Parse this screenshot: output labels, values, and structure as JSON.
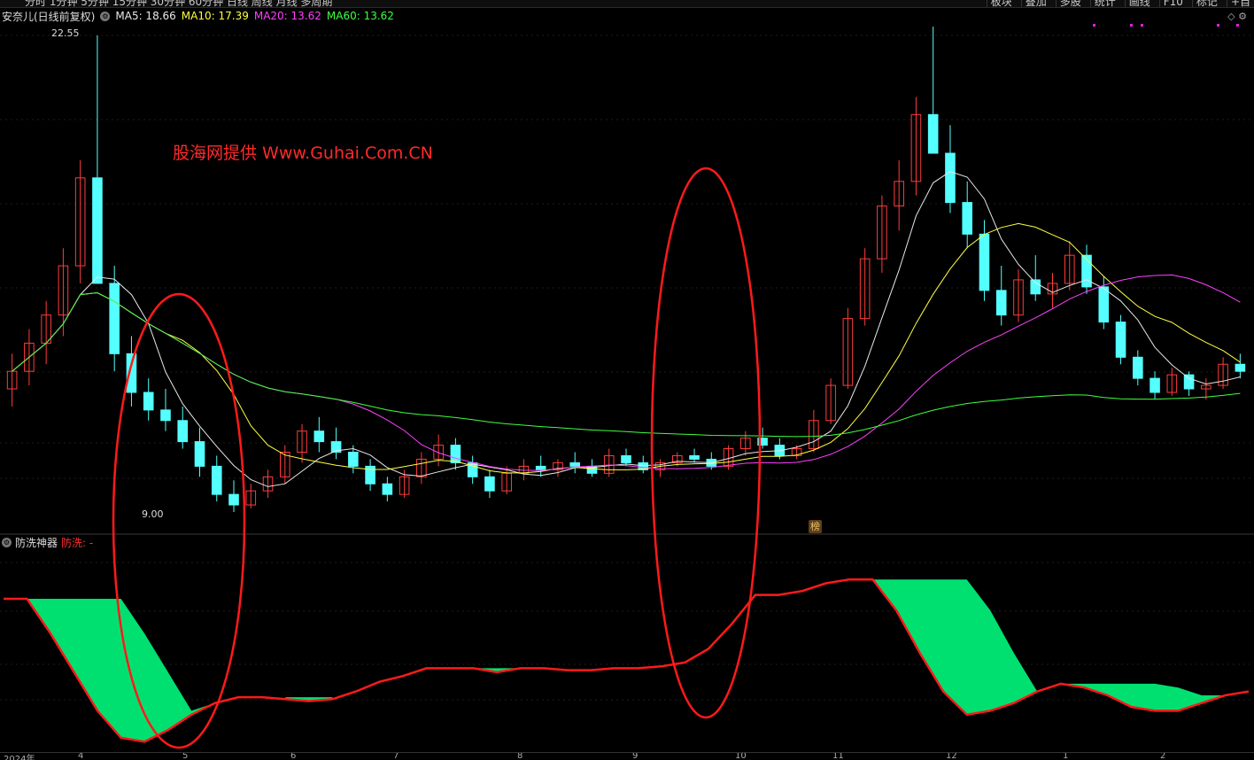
{
  "toolbar": {
    "periods": "分时  1分钟  5分钟  15分钟  30分钟  60分钟  日线  周线  月线  多周期",
    "tools": [
      "板块",
      "叠加",
      "多股",
      "统计",
      "画线",
      "F10",
      "标记",
      "+自"
    ]
  },
  "stock": {
    "name": "安奈儿(日线前复权)",
    "ma5": "MA5: 18.66",
    "ma10": "MA10: 17.39",
    "ma20": "MA20: 13.62",
    "ma60": "MA60: 13.62"
  },
  "annotations": {
    "high": "22.55",
    "low": "9.00",
    "watermark": "股海网提供 Www.Guhai.Com.CN",
    "bang": "榜"
  },
  "indicator": {
    "name": "防洗神器",
    "value": "防洗: -"
  },
  "xaxis": {
    "labels": [
      "2024年",
      "4",
      "5",
      "6",
      "7",
      "8",
      "9",
      "10",
      "11",
      "12",
      "1",
      "2"
    ]
  },
  "colors": {
    "up": "#ff3c3c",
    "down": "#54ffff",
    "ma5": "#e8e8e8",
    "ma10": "#ffff40",
    "ma20": "#ff40ff",
    "ma60": "#40ff40",
    "band": "#00e070",
    "line": "#ff1a1a",
    "ellipse": "#ff1a1a"
  },
  "chart_data": {
    "type": "candlestick",
    "price_range": [
      9.0,
      22.55
    ],
    "candles": [
      {
        "o": 12.5,
        "h": 13.5,
        "l": 12.0,
        "c": 13.0
      },
      {
        "o": 13.0,
        "h": 14.2,
        "l": 12.6,
        "c": 13.8
      },
      {
        "o": 13.8,
        "h": 15.0,
        "l": 13.2,
        "c": 14.6
      },
      {
        "o": 14.6,
        "h": 16.5,
        "l": 14.0,
        "c": 16.0
      },
      {
        "o": 16.0,
        "h": 19.0,
        "l": 15.5,
        "c": 18.5
      },
      {
        "o": 18.5,
        "h": 22.55,
        "l": 17.0,
        "c": 15.5
      },
      {
        "o": 15.5,
        "h": 16.0,
        "l": 13.0,
        "c": 13.5
      },
      {
        "o": 13.5,
        "h": 14.0,
        "l": 12.0,
        "c": 12.4
      },
      {
        "o": 12.4,
        "h": 12.8,
        "l": 11.6,
        "c": 11.9
      },
      {
        "o": 11.9,
        "h": 12.5,
        "l": 11.3,
        "c": 11.6
      },
      {
        "o": 11.6,
        "h": 12.0,
        "l": 10.8,
        "c": 11.0
      },
      {
        "o": 11.0,
        "h": 11.4,
        "l": 10.0,
        "c": 10.3
      },
      {
        "o": 10.3,
        "h": 10.6,
        "l": 9.3,
        "c": 9.5
      },
      {
        "o": 9.5,
        "h": 9.9,
        "l": 9.0,
        "c": 9.2
      },
      {
        "o": 9.2,
        "h": 9.8,
        "l": 9.1,
        "c": 9.6
      },
      {
        "o": 9.6,
        "h": 10.2,
        "l": 9.4,
        "c": 10.0
      },
      {
        "o": 10.0,
        "h": 10.9,
        "l": 9.8,
        "c": 10.7
      },
      {
        "o": 10.7,
        "h": 11.5,
        "l": 10.4,
        "c": 11.3
      },
      {
        "o": 11.3,
        "h": 11.7,
        "l": 10.7,
        "c": 11.0
      },
      {
        "o": 11.0,
        "h": 11.4,
        "l": 10.5,
        "c": 10.7
      },
      {
        "o": 10.7,
        "h": 10.9,
        "l": 10.1,
        "c": 10.3
      },
      {
        "o": 10.3,
        "h": 10.5,
        "l": 9.6,
        "c": 9.8
      },
      {
        "o": 9.8,
        "h": 10.0,
        "l": 9.3,
        "c": 9.5
      },
      {
        "o": 9.5,
        "h": 10.2,
        "l": 9.4,
        "c": 10.0
      },
      {
        "o": 10.0,
        "h": 10.7,
        "l": 9.8,
        "c": 10.5
      },
      {
        "o": 10.5,
        "h": 11.2,
        "l": 10.3,
        "c": 10.9
      },
      {
        "o": 10.9,
        "h": 11.1,
        "l": 10.2,
        "c": 10.4
      },
      {
        "o": 10.4,
        "h": 10.6,
        "l": 9.8,
        "c": 10.0
      },
      {
        "o": 10.0,
        "h": 10.2,
        "l": 9.4,
        "c": 9.6
      },
      {
        "o": 9.6,
        "h": 10.3,
        "l": 9.5,
        "c": 10.1
      },
      {
        "o": 10.1,
        "h": 10.5,
        "l": 9.9,
        "c": 10.3
      },
      {
        "o": 10.3,
        "h": 10.6,
        "l": 10.0,
        "c": 10.2
      },
      {
        "o": 10.2,
        "h": 10.5,
        "l": 10.0,
        "c": 10.4
      },
      {
        "o": 10.4,
        "h": 10.7,
        "l": 10.1,
        "c": 10.3
      },
      {
        "o": 10.3,
        "h": 10.5,
        "l": 10.0,
        "c": 10.1
      },
      {
        "o": 10.1,
        "h": 10.8,
        "l": 10.0,
        "c": 10.6
      },
      {
        "o": 10.6,
        "h": 10.8,
        "l": 10.3,
        "c": 10.4
      },
      {
        "o": 10.4,
        "h": 10.6,
        "l": 10.1,
        "c": 10.2
      },
      {
        "o": 10.2,
        "h": 10.5,
        "l": 10.0,
        "c": 10.4
      },
      {
        "o": 10.4,
        "h": 10.7,
        "l": 10.3,
        "c": 10.6
      },
      {
        "o": 10.6,
        "h": 10.8,
        "l": 10.4,
        "c": 10.5
      },
      {
        "o": 10.5,
        "h": 10.7,
        "l": 10.2,
        "c": 10.3
      },
      {
        "o": 10.3,
        "h": 10.9,
        "l": 10.2,
        "c": 10.8
      },
      {
        "o": 10.8,
        "h": 11.3,
        "l": 10.6,
        "c": 11.1
      },
      {
        "o": 11.1,
        "h": 11.4,
        "l": 10.8,
        "c": 10.9
      },
      {
        "o": 10.9,
        "h": 11.1,
        "l": 10.5,
        "c": 10.6
      },
      {
        "o": 10.6,
        "h": 10.9,
        "l": 10.5,
        "c": 10.8
      },
      {
        "o": 10.8,
        "h": 11.9,
        "l": 10.7,
        "c": 11.6
      },
      {
        "o": 11.6,
        "h": 12.8,
        "l": 11.5,
        "c": 12.6
      },
      {
        "o": 12.6,
        "h": 14.8,
        "l": 12.5,
        "c": 14.5
      },
      {
        "o": 14.5,
        "h": 16.5,
        "l": 14.3,
        "c": 16.2
      },
      {
        "o": 16.2,
        "h": 18.0,
        "l": 15.8,
        "c": 17.7
      },
      {
        "o": 17.7,
        "h": 19.0,
        "l": 17.0,
        "c": 18.4
      },
      {
        "o": 18.4,
        "h": 20.8,
        "l": 18.0,
        "c": 20.3
      },
      {
        "o": 20.3,
        "h": 22.8,
        "l": 19.8,
        "c": 19.2
      },
      {
        "o": 19.2,
        "h": 20.0,
        "l": 17.5,
        "c": 17.8
      },
      {
        "o": 17.8,
        "h": 18.4,
        "l": 16.5,
        "c": 16.9
      },
      {
        "o": 16.9,
        "h": 17.3,
        "l": 15.0,
        "c": 15.3
      },
      {
        "o": 15.3,
        "h": 16.0,
        "l": 14.3,
        "c": 14.6
      },
      {
        "o": 14.6,
        "h": 15.9,
        "l": 14.4,
        "c": 15.6
      },
      {
        "o": 15.6,
        "h": 16.3,
        "l": 15.0,
        "c": 15.2
      },
      {
        "o": 15.2,
        "h": 15.8,
        "l": 14.8,
        "c": 15.5
      },
      {
        "o": 15.5,
        "h": 16.7,
        "l": 15.3,
        "c": 16.3
      },
      {
        "o": 16.3,
        "h": 16.6,
        "l": 15.2,
        "c": 15.4
      },
      {
        "o": 15.4,
        "h": 15.7,
        "l": 14.2,
        "c": 14.4
      },
      {
        "o": 14.4,
        "h": 14.6,
        "l": 13.2,
        "c": 13.4
      },
      {
        "o": 13.4,
        "h": 13.6,
        "l": 12.6,
        "c": 12.8
      },
      {
        "o": 12.8,
        "h": 13.0,
        "l": 12.2,
        "c": 12.4
      },
      {
        "o": 12.4,
        "h": 13.1,
        "l": 12.3,
        "c": 12.9
      },
      {
        "o": 12.9,
        "h": 13.0,
        "l": 12.3,
        "c": 12.5
      },
      {
        "o": 12.5,
        "h": 12.8,
        "l": 12.2,
        "c": 12.6
      },
      {
        "o": 12.6,
        "h": 13.4,
        "l": 12.5,
        "c": 13.2
      },
      {
        "o": 13.2,
        "h": 13.5,
        "l": 12.8,
        "c": 13.0
      }
    ],
    "indicator_line": [
      78,
      78,
      60,
      40,
      20,
      6,
      4,
      10,
      18,
      24,
      27,
      27,
      26,
      25,
      26,
      30,
      35,
      38,
      42,
      42,
      42,
      40,
      42,
      42,
      41,
      41,
      42,
      42,
      43,
      45,
      52,
      65,
      80,
      80,
      82,
      86,
      88,
      88,
      72,
      50,
      30,
      18,
      20,
      24,
      30,
      34,
      32,
      28,
      22,
      20,
      20,
      24,
      28,
      30
    ]
  }
}
